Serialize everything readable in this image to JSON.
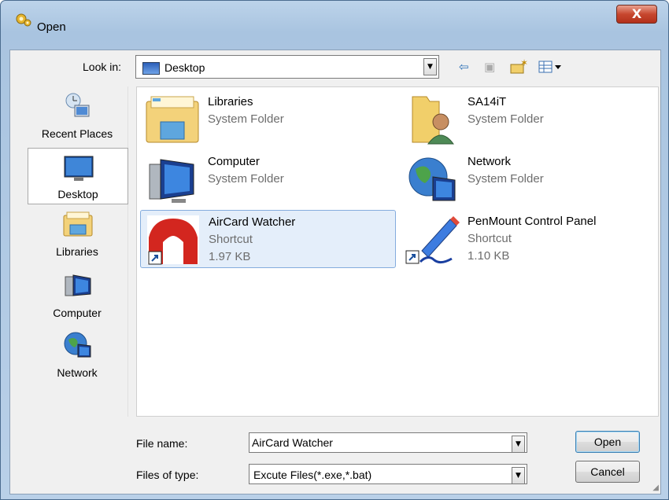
{
  "window": {
    "title": "Open",
    "close_label": "X"
  },
  "look_in": {
    "label": "Look in:",
    "value": "Desktop"
  },
  "toolbar": {
    "back_icon": "back-arrow-icon",
    "up_icon": "up-folder-icon",
    "new_folder_icon": "new-folder-icon",
    "views_icon": "views-menu-icon"
  },
  "places": [
    {
      "label": "Recent Places",
      "icon": "recent-places-icon"
    },
    {
      "label": "Desktop",
      "icon": "desktop-icon",
      "selected": true
    },
    {
      "label": "Libraries",
      "icon": "libraries-icon"
    },
    {
      "label": "Computer",
      "icon": "computer-icon"
    },
    {
      "label": "Network",
      "icon": "network-icon"
    }
  ],
  "files": [
    {
      "name": "Libraries",
      "type": "System Folder",
      "size": "",
      "icon": "libraries-folder-icon"
    },
    {
      "name": "SA14iT",
      "type": "System Folder",
      "size": "",
      "icon": "user-folder-icon"
    },
    {
      "name": "Computer",
      "type": "System Folder",
      "size": "",
      "icon": "computer-icon"
    },
    {
      "name": "Network",
      "type": "System Folder",
      "size": "",
      "icon": "network-icon"
    },
    {
      "name": "AirCard Watcher",
      "type": "Shortcut",
      "size": "1.97 KB",
      "icon": "aircard-watcher-shortcut-icon",
      "selected": true
    },
    {
      "name": "PenMount Control Panel",
      "type": "Shortcut",
      "size": "1.10 KB",
      "icon": "penmount-shortcut-icon"
    }
  ],
  "file_name": {
    "label": "File name:",
    "value": "AirCard Watcher"
  },
  "file_type": {
    "label": "Files of type:",
    "value": "Excute Files(*.exe,*.bat)"
  },
  "buttons": {
    "open": "Open",
    "cancel": "Cancel"
  },
  "colors": {
    "selection": "#e4eefa",
    "selection_border": "#84acdd",
    "close_red": "#c7472f"
  }
}
